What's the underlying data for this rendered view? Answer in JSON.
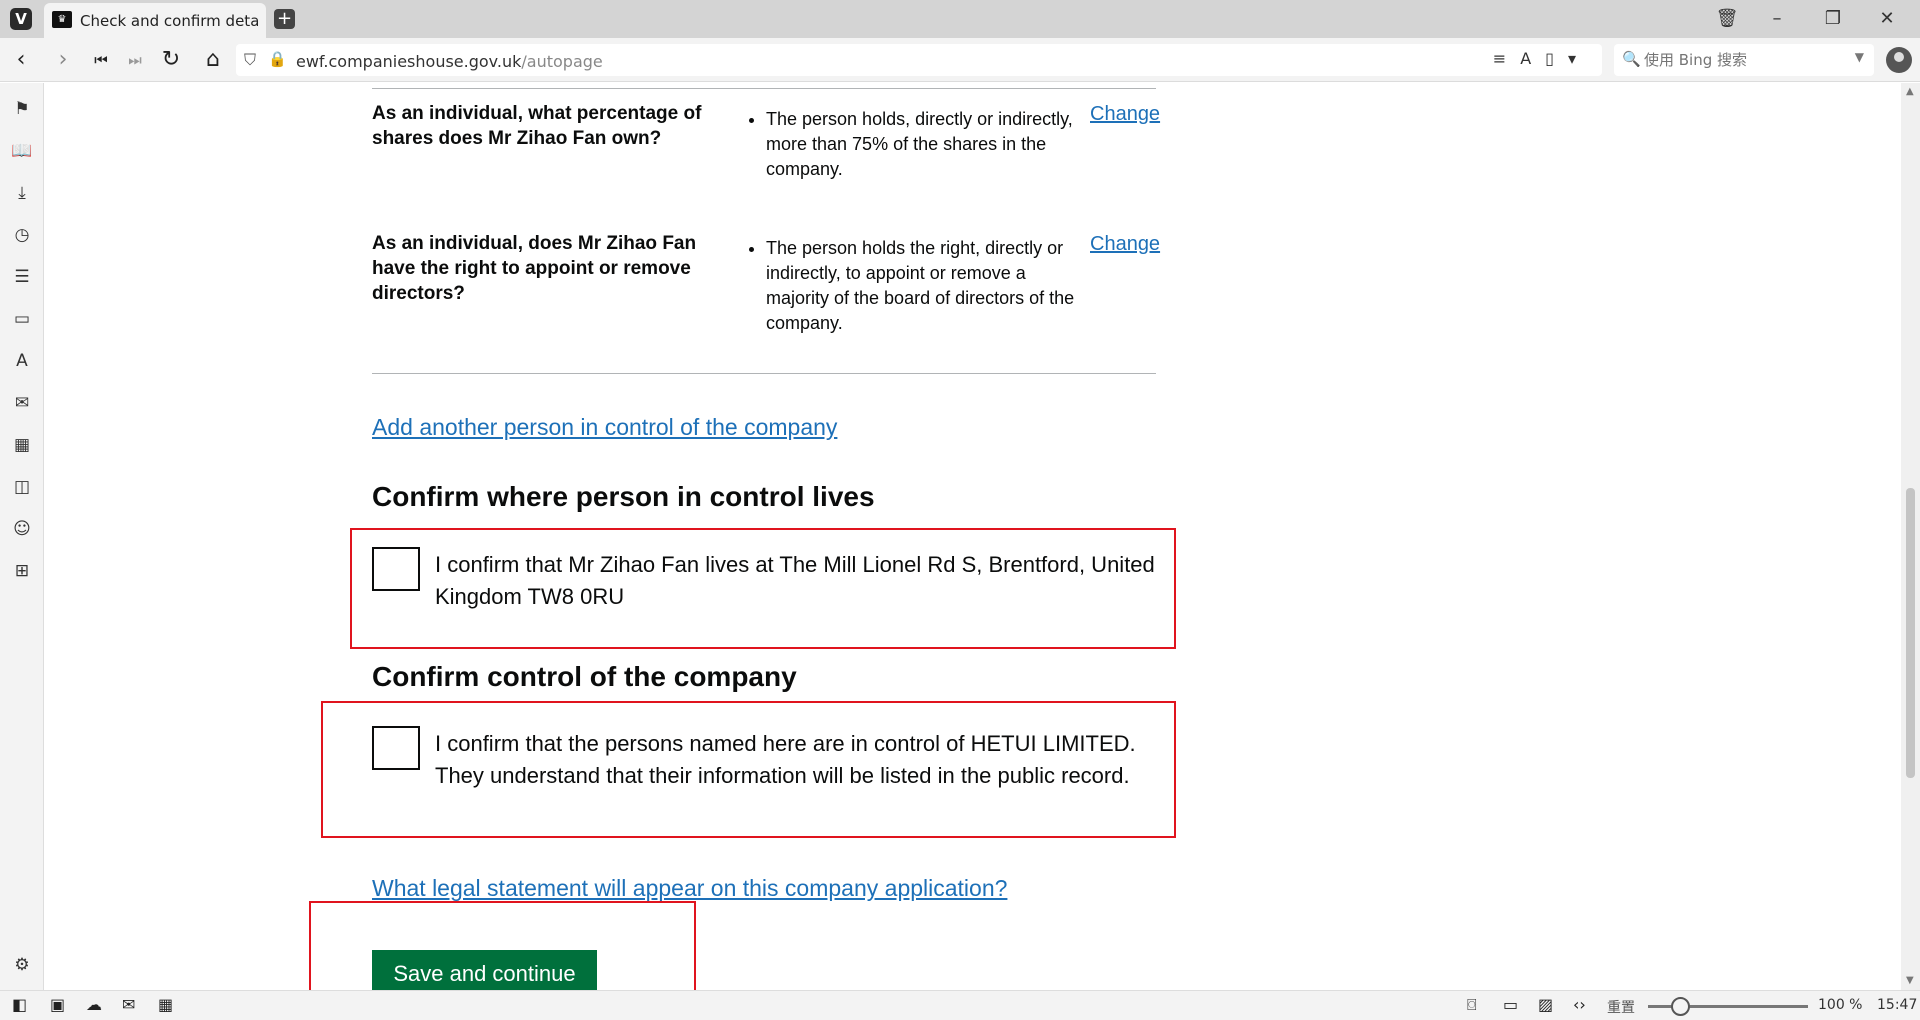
{
  "browser": {
    "logo": "V",
    "tab_title": "Check and confirm details c",
    "url_domain": "ewf.companieshouse.gov.uk",
    "url_path": "/autopage",
    "search_placeholder": "使用 Bing 搜索"
  },
  "statusbar": {
    "zoom_label": "重置",
    "zoom_value": "100 %",
    "time": "15:47"
  },
  "page": {
    "rows": [
      {
        "question": "As an individual, what percentage of shares does Mr Zihao Fan own?",
        "answer": "The person holds, directly or indirectly, more than 75% of the shares in the company.",
        "action": "Change"
      },
      {
        "question": "As an individual, does Mr Zihao Fan have the right to appoint or remove directors?",
        "answer": "The person holds the right, directly or indirectly, to appoint or remove a majority of the board of directors of the company.",
        "action": "Change"
      }
    ],
    "add_link": "Add another person in control of the company",
    "confirm_residence": {
      "heading": "Confirm where person in control lives",
      "label": "I confirm that Mr Zihao Fan lives at The Mill Lionel Rd S, Brentford, United Kingdom TW8 0RU",
      "checked": false
    },
    "confirm_control": {
      "heading": "Confirm control of the company",
      "label": "I confirm that the persons named here are in control of HETUI LIMITED. They understand that their information will be listed in the public record.",
      "checked": false
    },
    "legal_link": "What legal statement will appear on this company application?",
    "save_button": "Save and continue"
  },
  "colors": {
    "link": "#1d70b8",
    "button": "#00703c",
    "highlight_box": "#e0141e"
  }
}
